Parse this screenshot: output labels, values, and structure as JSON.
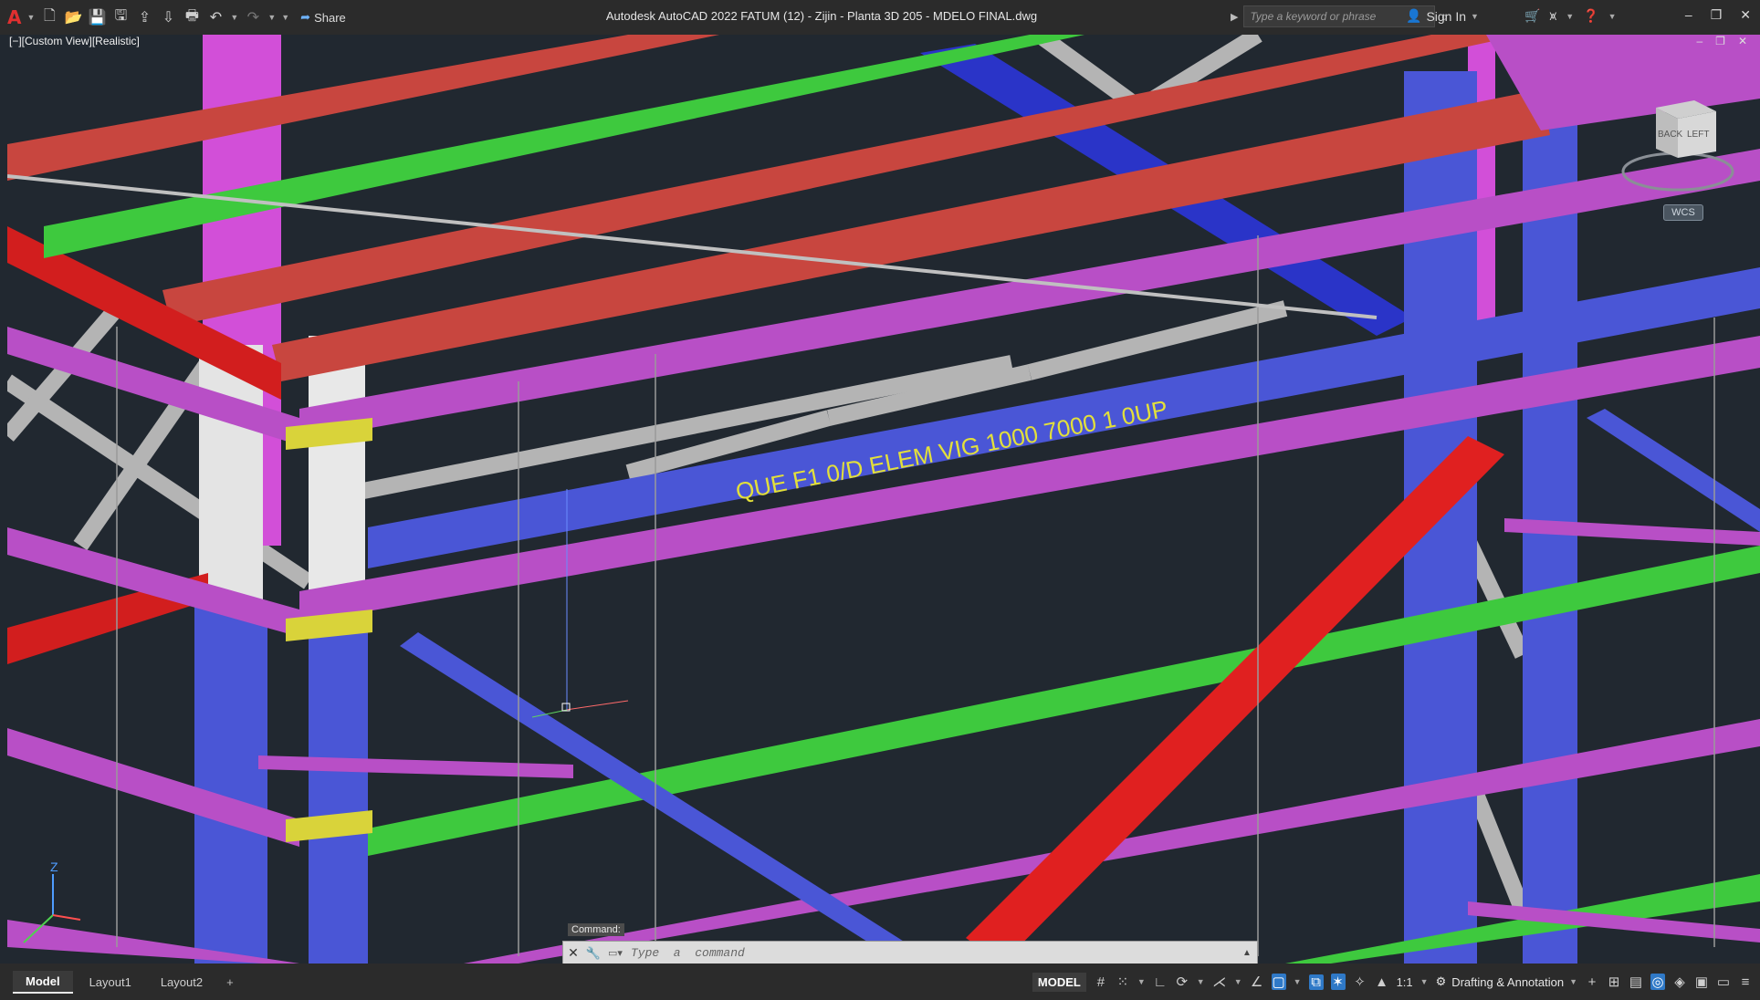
{
  "window": {
    "title": "Autodesk AutoCAD 2022    FATUM (12) - Zijin - Planta 3D 205 - MDELO FINAL.dwg",
    "app_logo": "A",
    "share_label": "Share",
    "search_placeholder": "Type a keyword or phrase",
    "sign_in_label": "Sign In",
    "minimize": "–",
    "restore": "❐",
    "close": "✕"
  },
  "viewport": {
    "view_label": "[−][Custom View][Realistic]",
    "viewcube_back": "BACK",
    "viewcube_left": "LEFT",
    "wcs_label": "WCS",
    "ucs_z": "Z",
    "model_text": "QUE F1 0/D ELEM VIG 1000 7000 1 0UP",
    "colors": {
      "background": "#212830",
      "red_beam": "#c8463f",
      "green_beam": "#3ec93e",
      "magenta_beam": "#b84fc6",
      "blue_column": "#4a56d6",
      "grey_brace": "#b4b4b4",
      "yellow_plate": "#d9d33a"
    }
  },
  "command": {
    "label": "Command:",
    "placeholder": "Type  a  command"
  },
  "layout_tabs": [
    "Model",
    "Layout1",
    "Layout2"
  ],
  "add_tab": "+",
  "status": {
    "model": "MODEL",
    "scale": "1:1",
    "workspace": "Drafting & Annotation"
  }
}
